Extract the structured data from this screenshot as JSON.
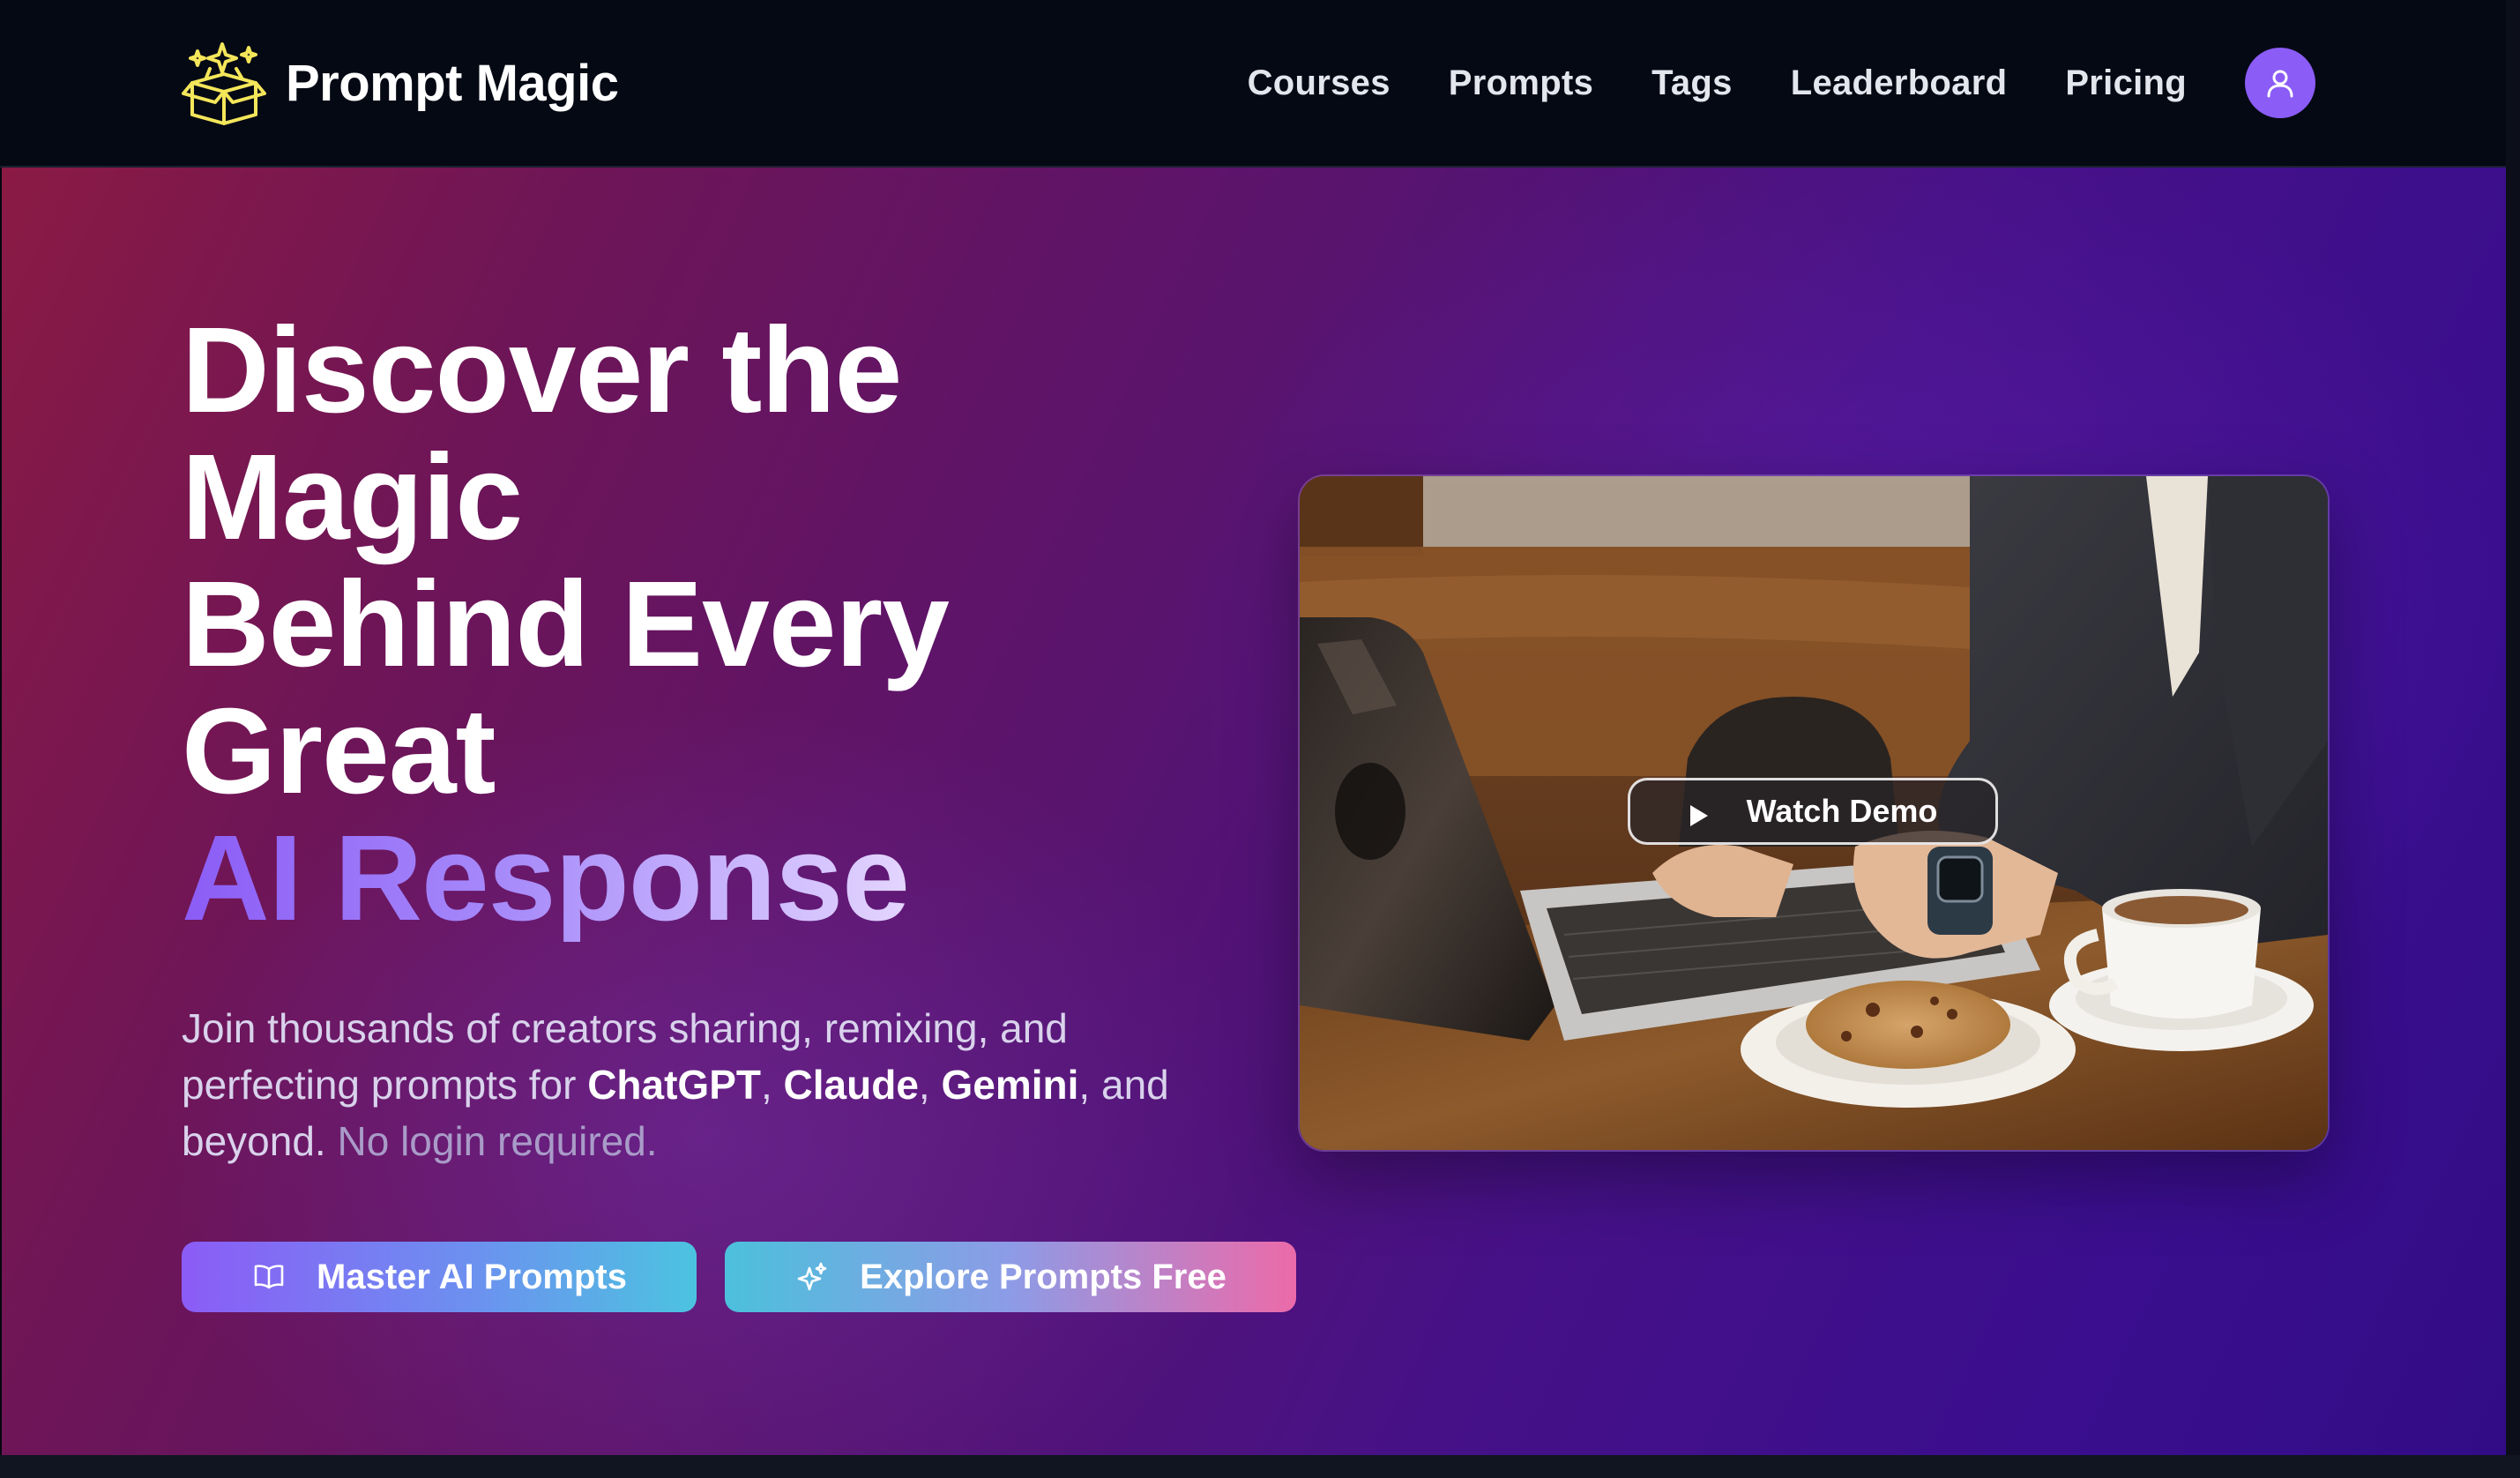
{
  "brand": {
    "name": "Prompt Magic",
    "logo_icon": "magic-box-sparkles-icon",
    "logo_color": "#f4e65a"
  },
  "nav": {
    "items": [
      {
        "label": "Courses"
      },
      {
        "label": "Prompts"
      },
      {
        "label": "Tags"
      },
      {
        "label": "Leaderboard"
      },
      {
        "label": "Pricing"
      }
    ],
    "avatar_icon": "user-icon",
    "avatar_color": "#8b5cf6"
  },
  "hero": {
    "headline": {
      "line1": "Discover the",
      "line2": "Magic",
      "line3": "Behind Every",
      "line4": "Great",
      "accent": "AI Response"
    },
    "subtext": {
      "part1": "Join thousands of creators sharing, remixing, and perfecting prompts for ",
      "model1": "ChatGPT",
      "sep1": ", ",
      "model2": "Claude",
      "sep2": ", ",
      "model3": "Gemini",
      "part2": ", and beyond. ",
      "muted": "No login required."
    },
    "buttons": {
      "primary": {
        "label": "Master AI Prompts",
        "icon": "book-open-icon"
      },
      "secondary": {
        "label": "Explore Prompts Free",
        "icon": "sparkles-icon"
      }
    },
    "video": {
      "cta_label": "Watch Demo",
      "cta_icon": "play-icon",
      "image_subject": "person typing on laptop in cafe with coffee cup and cookie"
    }
  },
  "colors": {
    "header_bg": "#050914",
    "hero_gradient_start": "#8a1a44",
    "hero_gradient_end": "#320c86",
    "accent_purple": "#8b5cf6",
    "accent_cyan": "#4cc3e0",
    "accent_pink": "#ec6aa9"
  }
}
